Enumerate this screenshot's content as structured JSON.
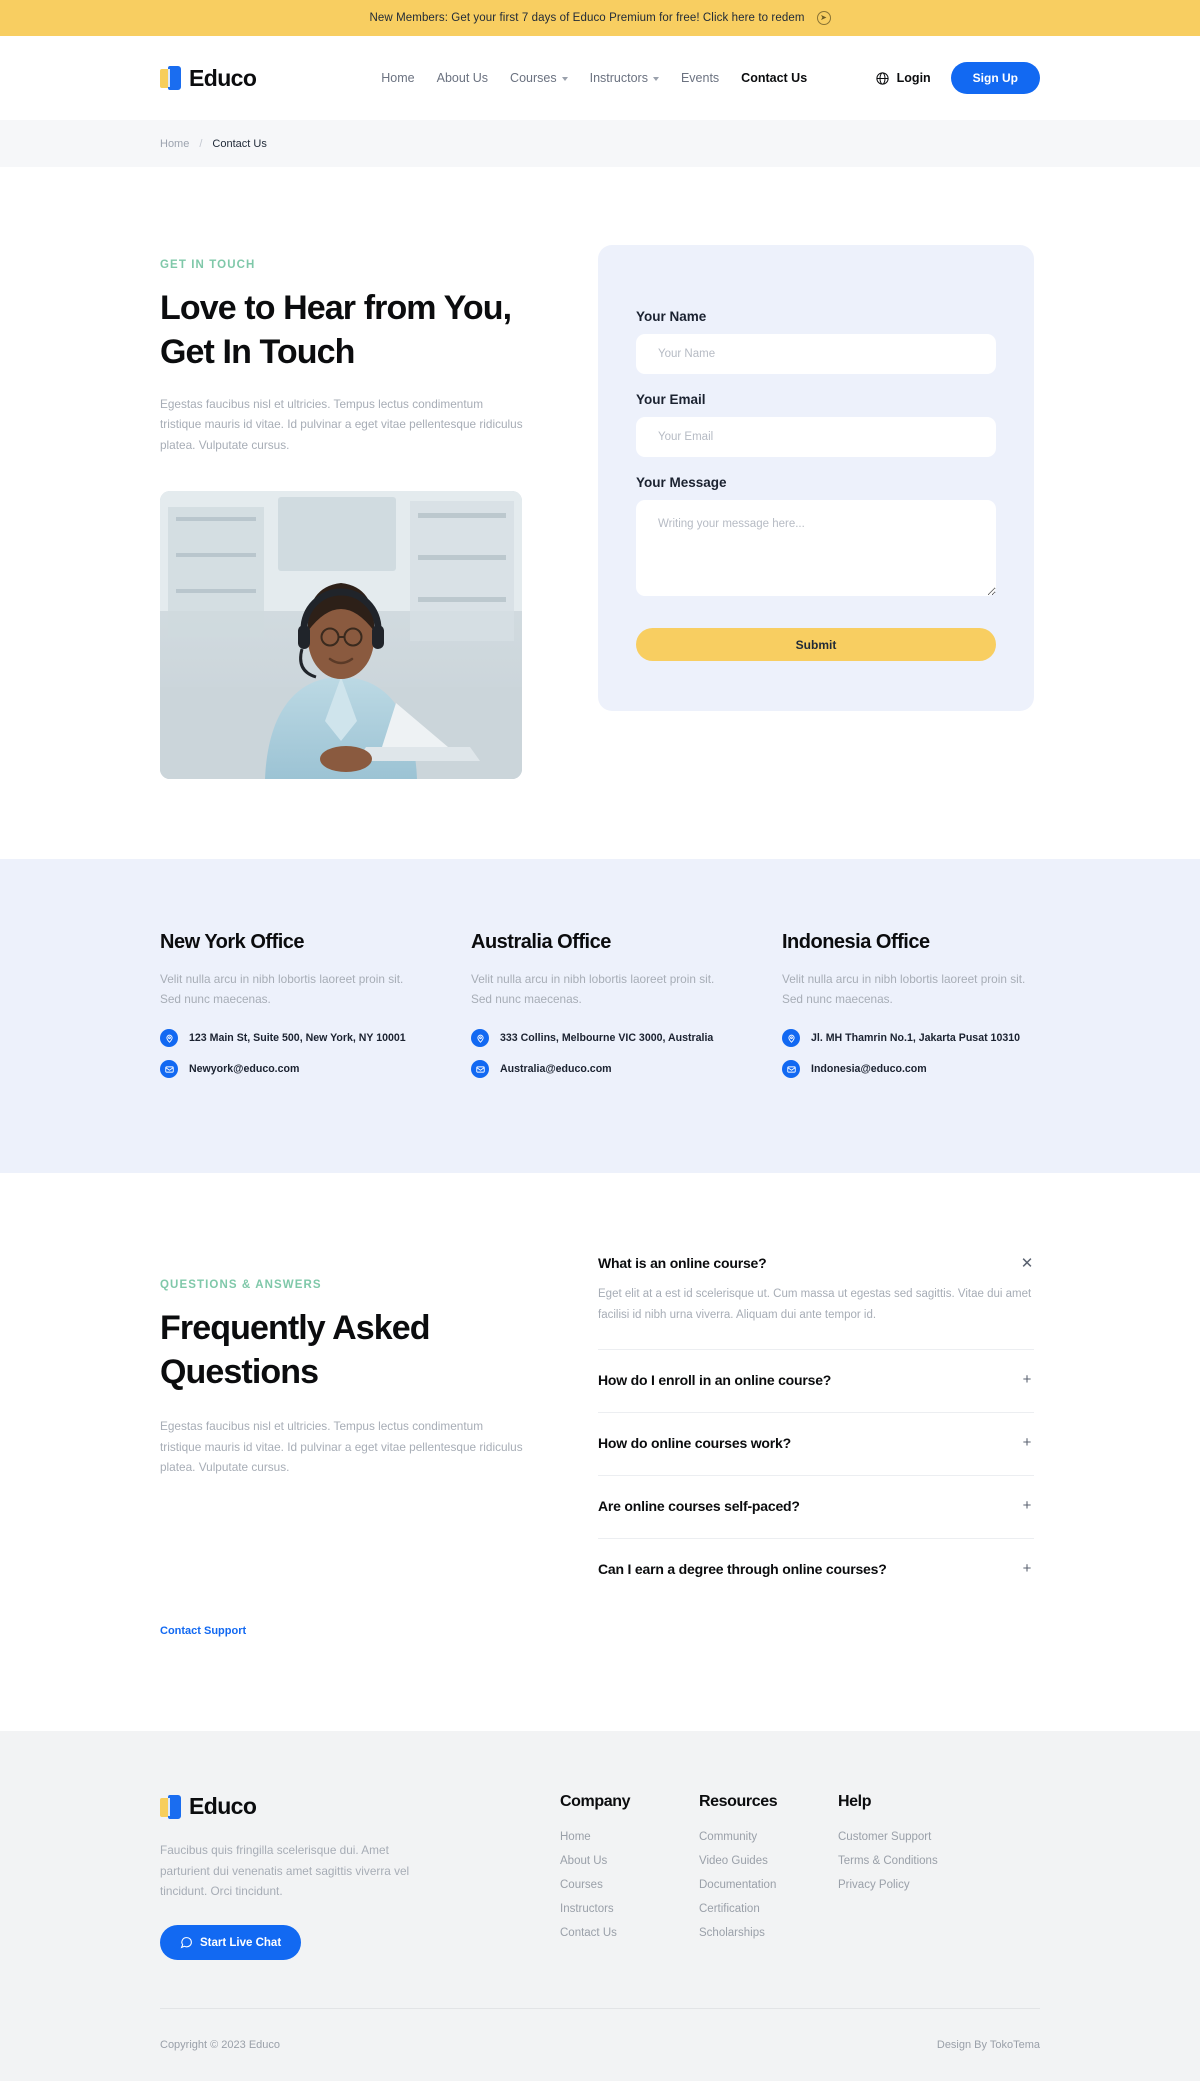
{
  "announcement": {
    "text": "New Members: Get your first 7 days of Educo Premium for free! Click here to redem",
    "arrow_icon": "arrow-right-circle-icon"
  },
  "header": {
    "brand": "Educo",
    "nav": [
      {
        "label": "Home",
        "dropdown": false,
        "active": false
      },
      {
        "label": "About Us",
        "dropdown": false,
        "active": false
      },
      {
        "label": "Courses",
        "dropdown": true,
        "active": false
      },
      {
        "label": "Instructors",
        "dropdown": true,
        "active": false
      },
      {
        "label": "Events",
        "dropdown": false,
        "active": false
      },
      {
        "label": "Contact Us",
        "dropdown": false,
        "active": true
      }
    ],
    "login_label": "Login",
    "signup_label": "Sign Up",
    "accent_blue": "#1269F2",
    "accent_yellow": "#F8CE61"
  },
  "breadcrumb": {
    "home": "Home",
    "separator": "/",
    "current": "Contact Us"
  },
  "contact": {
    "eyebrow": "GET IN TOUCH",
    "title": "Love to Hear from You, Get In Touch",
    "description": "Egestas faucibus nisl et ultricies. Tempus lectus condimentum tristique mauris id vitae. Id pulvinar a eget vitae pellentesque ridiculus platea. Vulputate cursus.",
    "photo_alt": "customer support agent with headset at laptop"
  },
  "form": {
    "name_label": "Your Name",
    "name_placeholder": "Your Name",
    "email_label": "Your Email",
    "email_placeholder": "Your Email",
    "message_label": "Your Message",
    "message_placeholder": "Writing your message here...",
    "submit_label": "Submit"
  },
  "offices": [
    {
      "title": "New York Office",
      "description": "Velit nulla arcu in nibh lobortis laoreet proin sit. Sed nunc maecenas.",
      "address": "123 Main St, Suite 500, New York, NY 10001",
      "email": "Newyork@educo.com"
    },
    {
      "title": "Australia Office",
      "description": "Velit nulla arcu in nibh lobortis laoreet proin sit. Sed nunc maecenas.",
      "address": "333 Collins, Melbourne VIC 3000, Australia",
      "email": "Australia@educo.com"
    },
    {
      "title": "Indonesia Office",
      "description": "Velit nulla arcu in nibh lobortis laoreet proin sit. Sed nunc maecenas.",
      "address": "Jl. MH Thamrin No.1, Jakarta Pusat 10310",
      "email": "Indonesia@educo.com"
    }
  ],
  "faq": {
    "eyebrow": "QUESTIONS & ANSWERS",
    "title": "Frequently Asked Questions",
    "description": "Egestas faucibus nisl et ultricies. Tempus lectus condimentum tristique mauris id vitae. Id pulvinar a eget vitae pellentesque ridiculus platea. Vulputate cursus.",
    "support_link": "Contact Support",
    "items": [
      {
        "question": "What is an online course?",
        "answer": "Eget elit at a est id scelerisque ut. Cum massa ut egestas sed sagittis. Vitae dui amet facilisi id nibh urna viverra. Aliquam dui ante tempor id.",
        "open": true,
        "icon": "close-icon",
        "icon_glyph": "✕"
      },
      {
        "question": "How do I enroll in an online course?",
        "answer": "",
        "open": false,
        "icon": "plus-icon",
        "icon_glyph": "+"
      },
      {
        "question": "How do online courses work?",
        "answer": "",
        "open": false,
        "icon": "plus-icon",
        "icon_glyph": "+"
      },
      {
        "question": "Are online courses self-paced?",
        "answer": "",
        "open": false,
        "icon": "plus-icon",
        "icon_glyph": "+"
      },
      {
        "question": "Can I earn a degree through online courses?",
        "answer": "",
        "open": false,
        "icon": "plus-icon",
        "icon_glyph": "+"
      }
    ]
  },
  "footer": {
    "brand": "Educo",
    "description": "Faucibus quis fringilla scelerisque dui. Amet parturient dui venenatis amet sagittis viverra vel tincidunt. Orci tincidunt.",
    "live_chat_label": "Start Live Chat",
    "columns": [
      {
        "title": "Company",
        "links": [
          "Home",
          "About Us",
          "Courses",
          "Instructors",
          "Contact Us"
        ]
      },
      {
        "title": "Resources",
        "links": [
          "Community",
          "Video Guides",
          "Documentation",
          "Certification",
          "Scholarships"
        ]
      },
      {
        "title": "Help",
        "links": [
          "Customer Support",
          "Terms & Conditions",
          "Privacy Policy"
        ]
      }
    ],
    "copyright": "Copyright © 2023 Educo",
    "design_by": "Design By TokoTema"
  }
}
